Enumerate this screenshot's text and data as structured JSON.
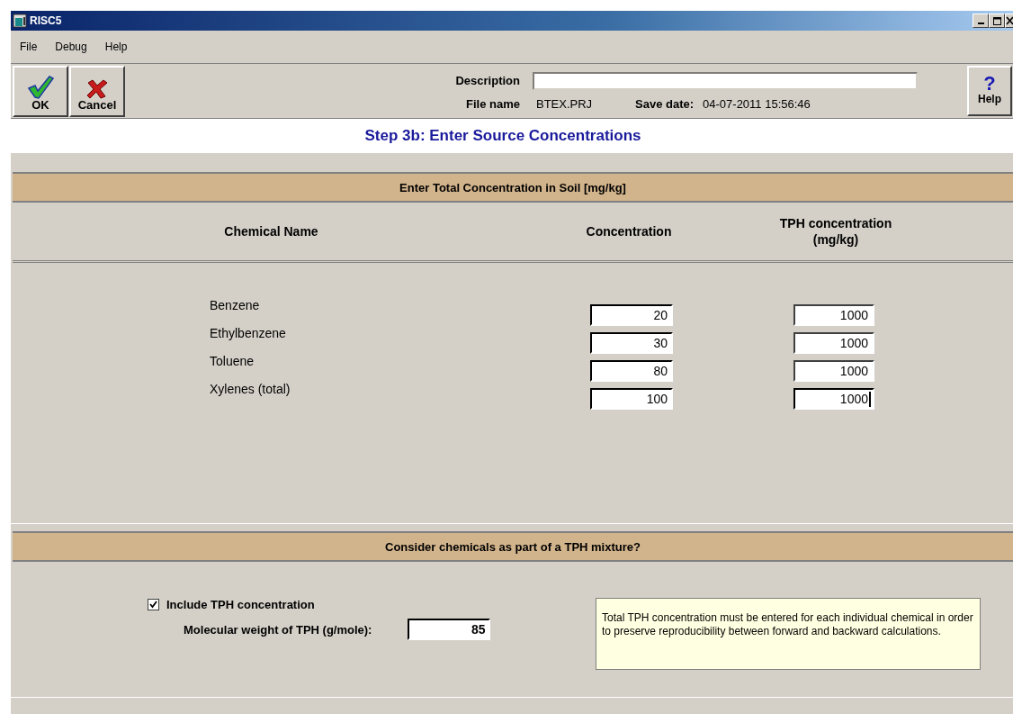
{
  "window": {
    "title": "RISC5"
  },
  "menu": [
    {
      "label": "File"
    },
    {
      "label": "Debug"
    },
    {
      "label": "Help"
    }
  ],
  "toolbar": {
    "ok": "OK",
    "cancel": "Cancel",
    "help": "Help",
    "help_glyph": "?"
  },
  "project": {
    "description_label": "Description",
    "file_label": "File name",
    "file_name": "BTEX.PRJ",
    "save_label": "Save date:",
    "save_date": "04-07-2011  15:56:46"
  },
  "step_title": "Step 3b:  Enter Source Concentrations",
  "concentration_section": {
    "header": "Enter Total Concentration in Soil [mg/kg]",
    "columns": [
      "Chemical Name",
      "Concentration",
      "TPH concentration\n(mg/kg)"
    ],
    "rows": [
      {
        "name": "Benzene",
        "concentration": "20",
        "tph": "1000",
        "focused": false
      },
      {
        "name": "Ethylbenzene",
        "concentration": "30",
        "tph": "1000",
        "focused": false
      },
      {
        "name": "Toluene",
        "concentration": "80",
        "tph": "1000",
        "focused": false
      },
      {
        "name": "Xylenes (total)",
        "concentration": "100",
        "tph": "1000",
        "focused": true
      }
    ]
  },
  "tph_section": {
    "header": "Consider chemicals as part of a TPH mixture?",
    "include": {
      "label": "Include TPH concentration",
      "checked": true
    },
    "mw_label": "Molecular weight of TPH (g/mole):",
    "mw_value": "85",
    "note": "Total TPH concentration must be entered for each individual chemical in order to preserve reproducibility between forward and backward calculations."
  }
}
